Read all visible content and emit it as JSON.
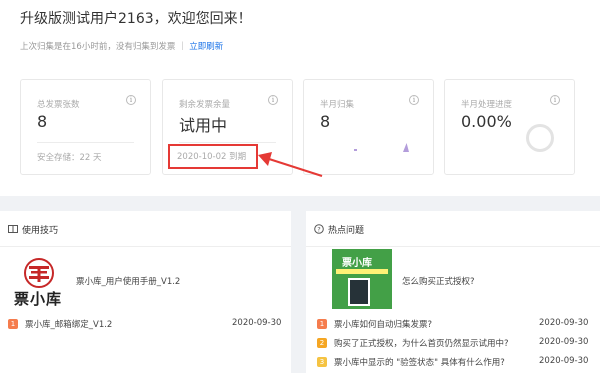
{
  "header": {
    "welcome": "升级版测试用户2163，欢迎您回来！",
    "subline_text": "上次归集是在16小时前，没有归集到发票 ｜",
    "refresh_label": "立即刷新"
  },
  "cards": [
    {
      "title": "总发票张数",
      "value": "8",
      "footer": "安全存储：22 天"
    },
    {
      "title": "剩余发票余量",
      "value": "试用中",
      "footer": "2020-10-02 到期"
    },
    {
      "title": "半月归集",
      "value": "8",
      "footer": ""
    },
    {
      "title": "半月处理进度",
      "value": "0.00%",
      "footer": ""
    }
  ],
  "tips": {
    "title": "使用技巧",
    "logo_text": "票小库",
    "manual_link": "票小库_用户使用手册_V1.2",
    "items": [
      {
        "num": "1",
        "text": "票小库_邮箱绑定_V1.2",
        "date": "2020-09-30"
      }
    ]
  },
  "faq": {
    "title": "热点问题",
    "thumb_title": "票小库",
    "featured_link": "怎么购买正式授权?",
    "items": [
      {
        "num": "1",
        "text": "票小库如何自动归集发票?",
        "date": "2020-09-30"
      },
      {
        "num": "2",
        "text": "购买了正式授权，为什么首页仍然显示试用中?",
        "date": "2020-09-30"
      },
      {
        "num": "3",
        "text": "票小库中显示的 \"验签状态\" 具体有什么作用?",
        "date": "2020-09-30"
      }
    ]
  },
  "colors": {
    "accent": "#1a73e8",
    "highlight_red": "#e53935",
    "badge_colors": [
      "#f57c4d",
      "#f5a623",
      "#f5c342"
    ]
  }
}
